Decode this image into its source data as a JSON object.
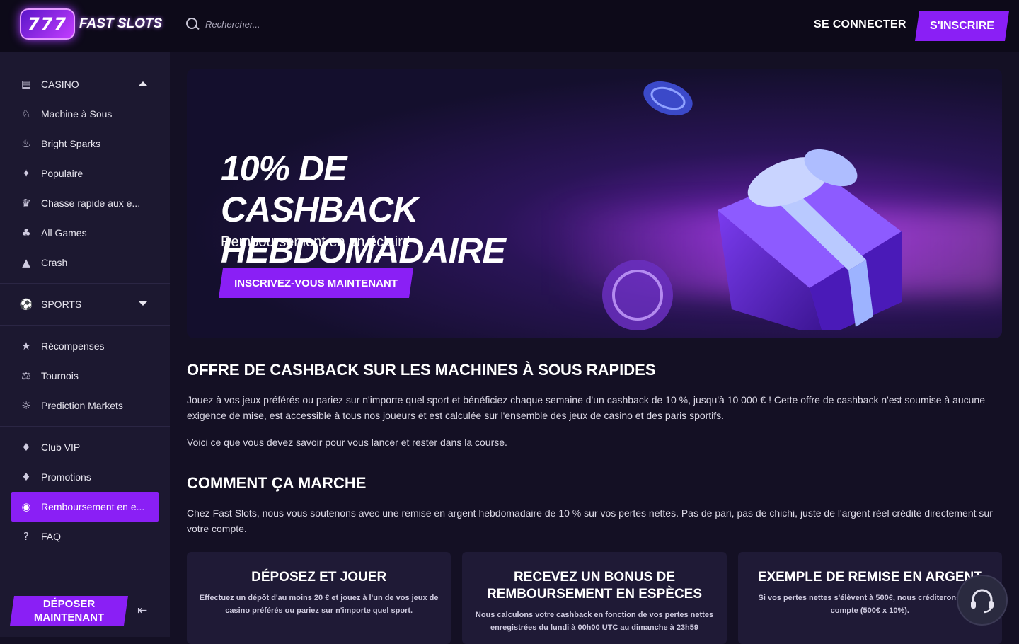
{
  "header": {
    "logo_number": "777",
    "logo_text": "FAST SLOTS",
    "search_placeholder": "Rechercher...",
    "login_label": "SE CONNECTER",
    "signup_label": "S'INSCRIRE"
  },
  "sidebar": {
    "casino_label": "CASINO",
    "casino_items": [
      {
        "label": "Machine à Sous",
        "icon": "slot-machine-icon"
      },
      {
        "label": "Bright Sparks",
        "icon": "flame-icon"
      },
      {
        "label": "Populaire",
        "icon": "sparkle-icon"
      },
      {
        "label": "Chasse rapide aux e...",
        "icon": "treasure-icon"
      },
      {
        "label": "All Games",
        "icon": "games-icon"
      },
      {
        "label": "Crash",
        "icon": "rocket-icon"
      }
    ],
    "sports_label": "SPORTS",
    "extras": [
      {
        "label": "Récompenses",
        "icon": "star-icon"
      },
      {
        "label": "Tournois",
        "icon": "trophy-icon"
      },
      {
        "label": "Prediction Markets",
        "icon": "prediction-icon"
      }
    ],
    "misc": [
      {
        "label": "Club VIP",
        "icon": "diamond-icon"
      },
      {
        "label": "Promotions",
        "icon": "promo-icon"
      },
      {
        "label": "Remboursement en e...",
        "icon": "cashback-icon"
      },
      {
        "label": "FAQ",
        "icon": "faq-icon"
      }
    ],
    "deposit_label": "DÉPOSER MAINTENANT"
  },
  "banner": {
    "title": "10% DE CASHBACK HEBDOMADAIRE",
    "subtitle": "Remboursement en un éclair !",
    "cta": "INSCRIVEZ-VOUS MAINTENANT"
  },
  "section1": {
    "title": "OFFRE DE CASHBACK SUR LES MACHINES À SOUS RAPIDES",
    "p1": "Jouez à vos jeux préférés ou pariez sur n'importe quel sport et bénéficiez chaque semaine d'un cashback de 10 %, jusqu'à 10 000 € ! Cette offre de cashback n'est soumise à aucune exigence de mise, est accessible à tous nos joueurs et est calculée sur l'ensemble des jeux de casino et des paris sportifs.",
    "p2": "Voici ce que vous devez savoir pour vous lancer et rester dans la course."
  },
  "section2": {
    "title": "COMMENT ÇA MARCHE",
    "p1": "Chez Fast Slots, nous vous soutenons avec une remise en argent hebdomadaire de 10 % sur vos pertes nettes. Pas de pari, pas de chichi, juste de l'argent réel crédité directement sur votre compte."
  },
  "cards": [
    {
      "title": "DÉPOSEZ ET JOUER",
      "text": "Effectuez un dépôt d'au moins 20 € et jouez à l'un de vos jeux de casino préférés ou pariez sur n'importe quel sport."
    },
    {
      "title": "RECEVEZ UN BONUS DE REMBOURSEMENT EN ESPÈCES",
      "text": "Nous calculons votre cashback en fonction de vos pertes nettes enregistrées du lundi à 00h00 UTC au dimanche à 23h59"
    },
    {
      "title": "EXEMPLE DE REMISE EN ARGENT",
      "text": "Si vos pertes nettes s'élèvent à 500€, nous créditerons votre compte (500€ x 10%)."
    }
  ],
  "colors": {
    "accent": "#8a1ff5",
    "bg": "#141024",
    "sidebar": "#1c1830",
    "header": "#0d0a19"
  }
}
